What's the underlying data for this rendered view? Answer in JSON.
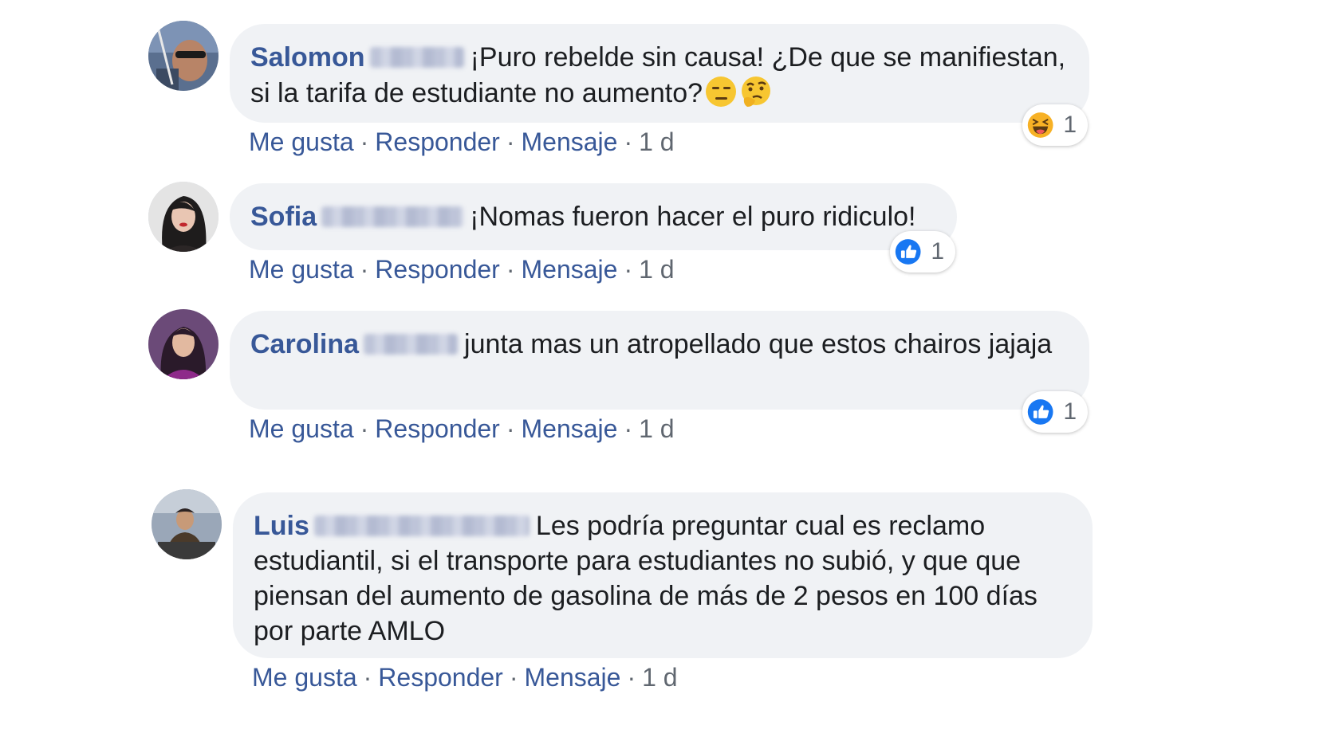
{
  "comments": [
    {
      "author": "Salomon",
      "text": "¡Puro rebelde sin causa! ¿De que se manifiestan, si la tarifa de estudiante no aumento?",
      "emoji": [
        "expressionless-face-emoji",
        "thinking-face-emoji"
      ],
      "actions": {
        "like": "Me gusta",
        "reply": "Responder",
        "message": "Mensaje",
        "time": "1 d"
      },
      "reaction": {
        "type": "haha-reaction-icon",
        "count": "1"
      }
    },
    {
      "author": "Sofia",
      "text": "¡Nomas fueron hacer el puro ridiculo!",
      "actions": {
        "like": "Me gusta",
        "reply": "Responder",
        "message": "Mensaje",
        "time": "1 d"
      },
      "reaction": {
        "type": "like-reaction-icon",
        "count": "1"
      }
    },
    {
      "author": "Carolina",
      "text": "junta mas un atropellado que estos chairos jajaja",
      "actions": {
        "like": "Me gusta",
        "reply": "Responder",
        "message": "Mensaje",
        "time": "1 d"
      },
      "reaction": {
        "type": "like-reaction-icon",
        "count": "1"
      }
    },
    {
      "author": "Luis",
      "text": "Les podría preguntar cual es reclamo estudiantil, si el transporte para estudiantes no subió, y que que piensan del aumento de gasolina de más de 2 pesos en 100 días por parte AMLO",
      "actions": {
        "like": "Me gusta",
        "reply": "Responder",
        "message": "Mensaje",
        "time": "1 d"
      }
    }
  ],
  "colors": {
    "link": "#385898",
    "bubble": "#f0f2f5",
    "like": "#1877f2",
    "haha": "#f7b125"
  }
}
